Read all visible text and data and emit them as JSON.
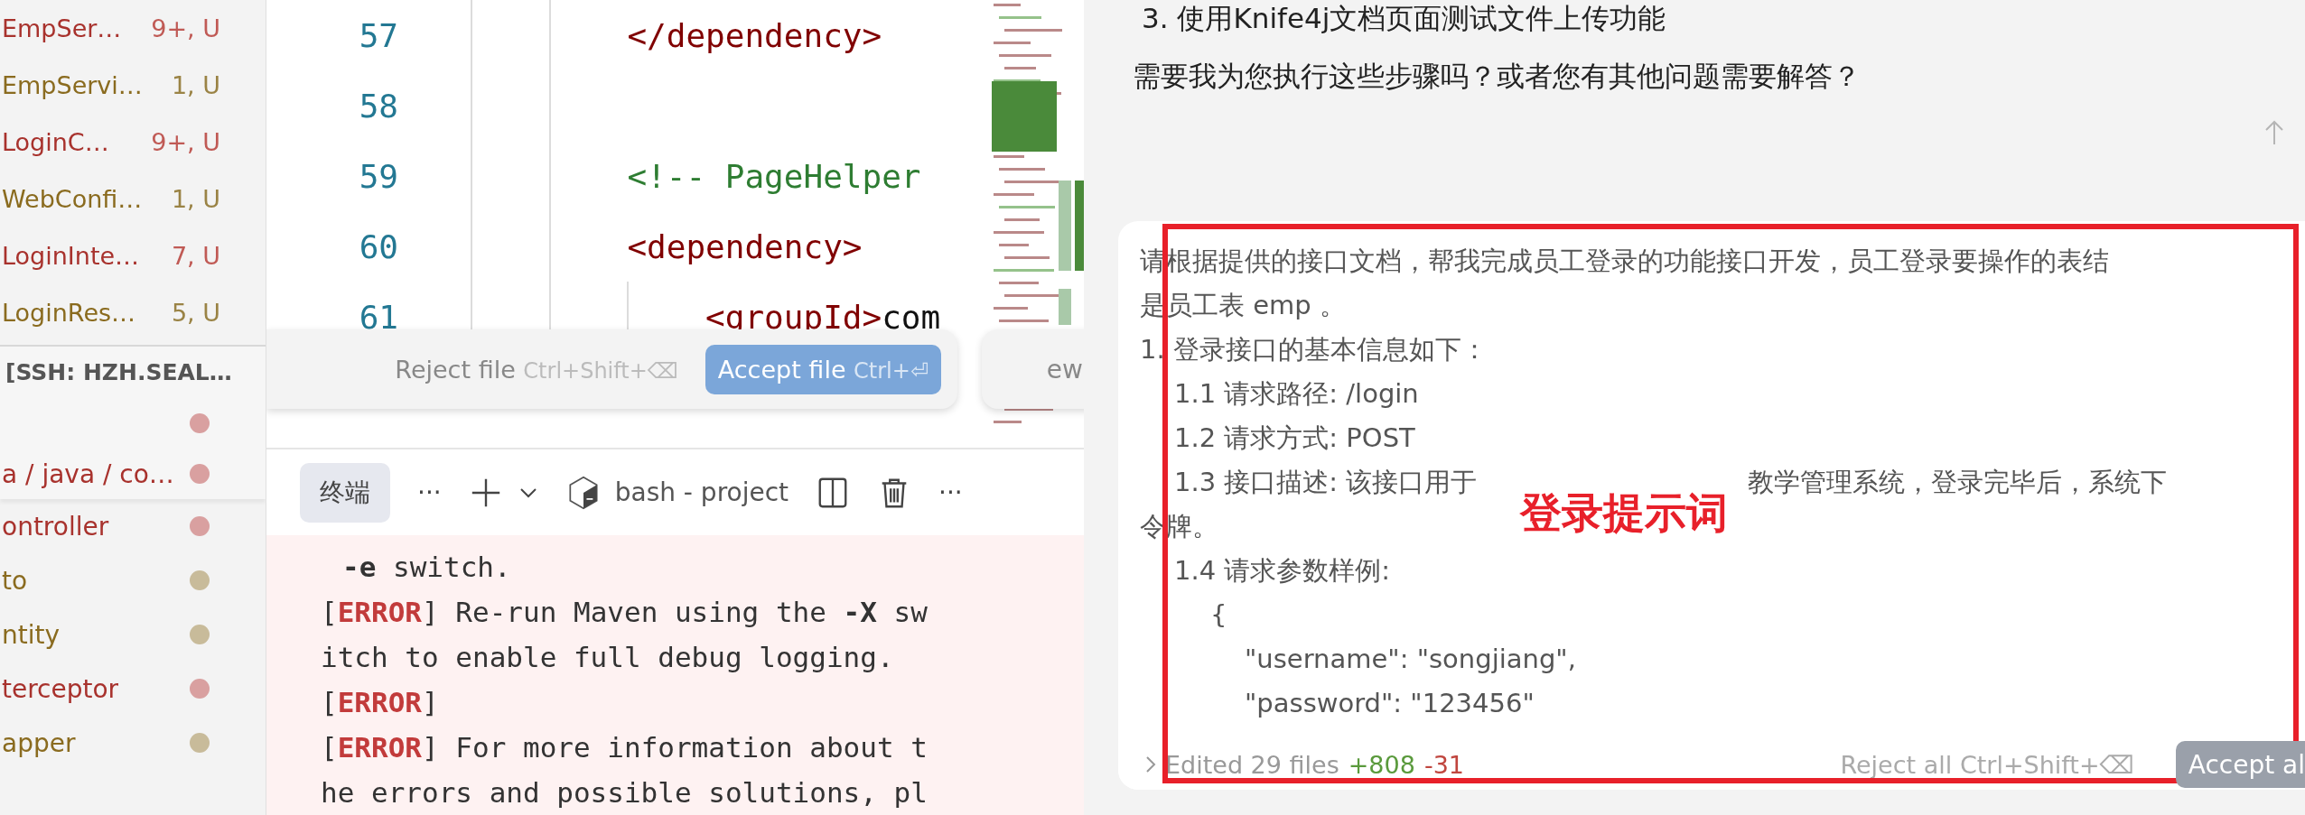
{
  "explorer": {
    "files": [
      {
        "name": "EmpSer…",
        "badge": "9+, U",
        "kind": "error"
      },
      {
        "name": "EmpServi…",
        "badge": "1, U",
        "kind": "warning"
      },
      {
        "name": "LoginC…",
        "badge": "9+, U",
        "kind": "error"
      },
      {
        "name": "WebConfi…",
        "badge": "1, U",
        "kind": "warning"
      },
      {
        "name": "LoginInte…",
        "badge": "7, U",
        "kind": "error"
      },
      {
        "name": "LoginRes…",
        "badge": "5, U",
        "kind": "warning"
      }
    ],
    "section_title": "[SSH: HZH.SEAL…",
    "sticky_rows": [
      {
        "color": "#d9a0a0"
      },
      {
        "label": "a / java / co…",
        "color": "#d9a0a0"
      }
    ],
    "folders": [
      {
        "label": "ontroller",
        "kind": "error",
        "color": "#d9a0a0"
      },
      {
        "label": "to",
        "kind": "warning",
        "color": "#c8bb9a"
      },
      {
        "label": "ntity",
        "kind": "warning",
        "color": "#c8bb9a"
      },
      {
        "label": "terceptor",
        "kind": "error",
        "color": "#d9a0a0"
      },
      {
        "label": "apper",
        "kind": "warning",
        "color": "#c8bb9a"
      }
    ]
  },
  "editor": {
    "lines": [
      {
        "number": "57",
        "tokens": [
          {
            "kind": "tag",
            "text": "        </dependency>"
          }
        ]
      },
      {
        "number": "58"
      },
      {
        "number": "59",
        "tokens": [
          {
            "kind": "comment",
            "text": "        <!-- PageHelper"
          }
        ]
      },
      {
        "number": "60",
        "tokens": [
          {
            "kind": "tag",
            "text": "        <dependency>"
          }
        ]
      },
      {
        "number": "61",
        "tokens": [
          {
            "kind": "tag",
            "text": "            <groupId>"
          },
          {
            "kind": "text",
            "text": "com"
          }
        ]
      }
    ],
    "review_bar": {
      "reject": "Reject file",
      "reject_shortcut": "Ctrl+Shift+⌫",
      "accept": "Accept file",
      "accept_shortcut": "Ctrl+⏎",
      "next_fragment": "ew"
    }
  },
  "terminal": {
    "tabs": [
      {
        "label": "终端",
        "selected": true
      }
    ],
    "more": "···",
    "shell": "bash - project",
    "actions_more": "···",
    "lines": [
      {
        "kind": "continuation",
        "segments": [
          {
            "kind": "bold",
            "text": "-e"
          },
          {
            "kind": "plain",
            "text": " switch."
          }
        ]
      },
      {
        "kind": "line",
        "segments": [
          {
            "kind": "plain",
            "text": "["
          },
          {
            "kind": "error",
            "text": "ERROR"
          },
          {
            "kind": "plain",
            "text": "] Re-run Maven using the "
          },
          {
            "kind": "bold",
            "text": "-X"
          },
          {
            "kind": "plain",
            "text": " sw"
          }
        ]
      },
      {
        "kind": "line",
        "segments": [
          {
            "kind": "plain",
            "text": "itch to enable full debug logging."
          }
        ]
      },
      {
        "kind": "line",
        "segments": [
          {
            "kind": "plain",
            "text": "["
          },
          {
            "kind": "error",
            "text": "ERROR"
          },
          {
            "kind": "plain",
            "text": "]"
          }
        ]
      },
      {
        "kind": "line",
        "segments": [
          {
            "kind": "plain",
            "text": "["
          },
          {
            "kind": "error",
            "text": "ERROR"
          },
          {
            "kind": "plain",
            "text": "] For more information about t"
          }
        ]
      },
      {
        "kind": "line",
        "segments": [
          {
            "kind": "plain",
            "text": "he errors and possible solutions, pl"
          }
        ]
      }
    ]
  },
  "chat": {
    "messages": [
      "3. 使用Knife4j文档页面测试文件上传功能",
      "需要我为您执行这些步骤吗？或者您有其他问题需要解答？"
    ],
    "prompt_lines": [
      {
        "kind": "para",
        "text": "请根据提供的接口文档，帮我完成员工登录的功能接口开发，员工登录要操作的表结"
      },
      {
        "kind": "para",
        "text": "是员工表 emp 。"
      },
      {
        "kind": "para",
        "text": "1. 登录接口的基本信息如下："
      },
      {
        "kind": "sub",
        "text": "1.1 请求路径: /login"
      },
      {
        "kind": "sub",
        "text": "1.2 请求方式: POST"
      },
      {
        "kind": "sub",
        "text": "1.3 接口描述: 该接口用于",
        "after": "教学管理系统，登录完毕后，系统下"
      },
      {
        "kind": "para",
        "text": "令牌。"
      },
      {
        "kind": "sub",
        "text": "1.4 请求参数样例:"
      },
      {
        "kind": "brace",
        "text": "{"
      },
      {
        "kind": "field",
        "text": "\"username\": \"songjiang\","
      },
      {
        "kind": "field",
        "text": "\"password\": \"123456\""
      }
    ],
    "edits": {
      "summary": "Edited 29 files",
      "added": "+808",
      "removed": "-31",
      "reject": "Reject all",
      "reject_shortcut": "Ctrl+Shift+⌫",
      "accept": "Accept al"
    },
    "annotation": {
      "label": "登录提示词"
    }
  }
}
